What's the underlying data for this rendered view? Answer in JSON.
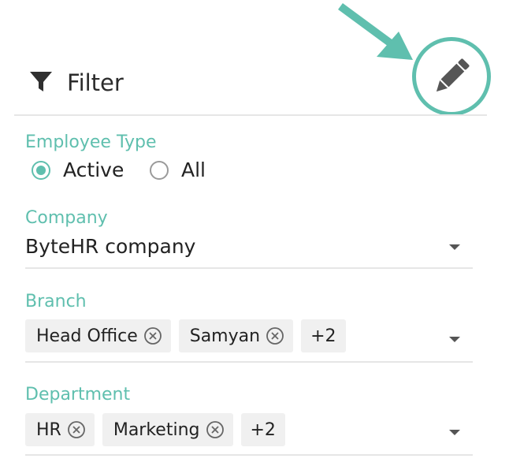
{
  "header": {
    "title": "Filter"
  },
  "colors": {
    "accent": "#5fbfae",
    "text": "#222222",
    "chip_bg": "#f0f0f0",
    "divider": "#e6e6e6"
  },
  "icons": {
    "filter": "filter-icon",
    "edit": "pencil-icon",
    "remove": "close-circle-icon",
    "dropdown": "caret-down-icon",
    "annotation": "arrow-icon"
  },
  "employee_type": {
    "label": "Employee Type",
    "options": [
      "Active",
      "All"
    ],
    "selected": "Active"
  },
  "company": {
    "label": "Company",
    "value": "ByteHR company"
  },
  "branch": {
    "label": "Branch",
    "chips": [
      "Head Office",
      "Samyan"
    ],
    "more": "+2"
  },
  "department": {
    "label": "Department",
    "chips": [
      "HR",
      "Marketing"
    ],
    "more": "+2"
  }
}
